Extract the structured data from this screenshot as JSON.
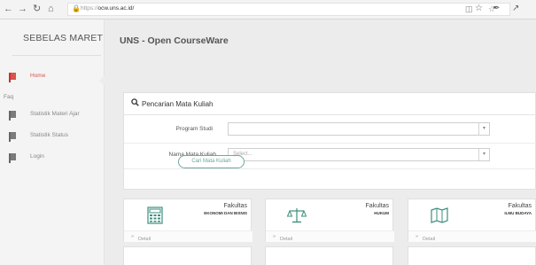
{
  "browser": {
    "url_prefix": "https://",
    "url_host": "ocw.uns.ac.id/",
    "nav_icons": [
      "back-icon",
      "forward-icon",
      "refresh-icon",
      "home-icon"
    ]
  },
  "sidebar": {
    "brand": "SEBELAS MARET",
    "items": [
      {
        "label": "Home",
        "active": true
      },
      {
        "label": "Statistik Materi Ajar",
        "active": false
      },
      {
        "label": "Statistik Status",
        "active": false
      },
      {
        "label": "Login",
        "active": false
      }
    ],
    "faq": "Faq"
  },
  "header": {
    "title": "UNS - Open CourseWare"
  },
  "search": {
    "title": "Pencarian Mata Kuliah",
    "program_label": "Program Studi",
    "program_value": "",
    "course_label": "Nama Mata Kuliah",
    "course_placeholder": "Select...",
    "button": "Cari Mata Kuliah"
  },
  "faculties": [
    {
      "title": "Fakultas",
      "name": "EKONOMI DAN BISNIS",
      "link": "Detail",
      "icon": "calculator-icon"
    },
    {
      "title": "Fakultas",
      "name": "HUKUM",
      "link": "Detail",
      "icon": "scales-icon"
    },
    {
      "title": "Fakultas",
      "name": "ILMU BUDAYA",
      "link": "Detail",
      "icon": "map-icon"
    }
  ],
  "colors": {
    "accent": "#d9534f",
    "button_outline": "#6fa8a0",
    "icon_green": "#3e8e7e"
  }
}
